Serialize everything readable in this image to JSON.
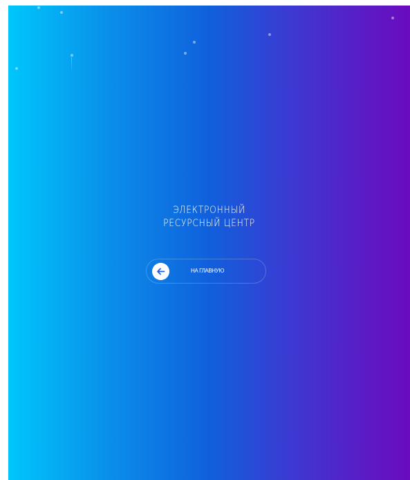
{
  "page": {
    "title_lines": [
      "ЭЛЕКТРОННЫЙ",
      "РЕСУРСНЫЙ ЦЕНТР"
    ]
  },
  "home_button": {
    "label": "НА ГЛАВНУЮ",
    "icon": "arrow-left-icon"
  },
  "colors": {
    "gradient_start": "#00c6fb",
    "gradient_mid": "#1060dc",
    "gradient_end": "#6a0bbf",
    "text": "#ffffff",
    "arrow": "#1a5fe0"
  }
}
